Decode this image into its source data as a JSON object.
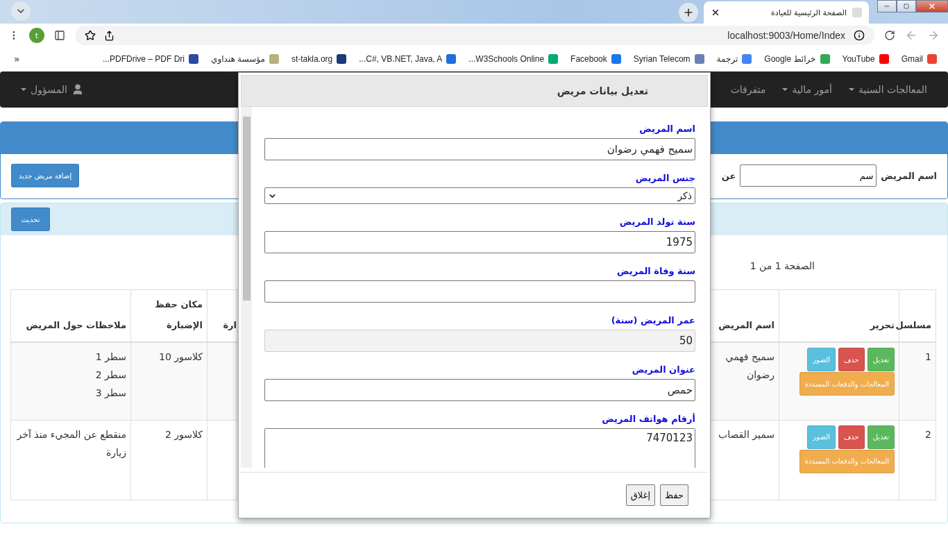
{
  "browser": {
    "tabs": [
      {
        "title": "الصفحة الرئيسية للعيادة",
        "selected": true
      }
    ],
    "address": "localhost:9003/Home/Index",
    "profile_initial": "t",
    "bookmarks": [
      {
        "label": "Gmail",
        "color": "#ea4335"
      },
      {
        "label": "YouTube",
        "color": "#ff0000"
      },
      {
        "label": "خرائط Google",
        "color": "#34a853"
      },
      {
        "label": "ترجمة",
        "color": "#4285f4"
      },
      {
        "label": "Syrian Telecom",
        "color": "#6a7fb5"
      },
      {
        "label": "Facebook",
        "color": "#1877f2"
      },
      {
        "label": "W3Schools Online...",
        "color": "#04aa6d"
      },
      {
        "label": "C#, VB.NET, Java, A...",
        "color": "#1e6fd9"
      },
      {
        "label": "st-takla.org",
        "color": "#1a3a7a"
      },
      {
        "label": "مؤسسة هنداوي",
        "color": "#b5b27a"
      },
      {
        "label": "PDFDrive – PDF Dri...",
        "color": "#2a49a8"
      }
    ],
    "overflow": "«"
  },
  "navbar": {
    "items": [
      {
        "label": "المعالجات السنية",
        "dropdown": true
      },
      {
        "label": "أمور مالية",
        "dropdown": true
      },
      {
        "label": "متفرقات",
        "dropdown": false
      }
    ],
    "user": {
      "label": "المسؤول"
    }
  },
  "search": {
    "label": "اسم المريض",
    "value": "سم",
    "next_label": "عن",
    "add_button": "إضافة مريض جديد"
  },
  "list": {
    "refresh_button": "تحديث",
    "pagination": "الصفحة 1 من 1",
    "columns": [
      "مسلسل",
      "تحرير",
      "اسم المريض",
      null,
      "ارة",
      "مكان حفظ الإضبارة",
      "ملاحظات حول المريض"
    ],
    "rows": [
      {
        "serial": "1",
        "actions": [
          {
            "label": "تعديل",
            "kind": "success"
          },
          {
            "label": "حذف",
            "kind": "danger"
          },
          {
            "label": "الصور",
            "kind": "info"
          },
          {
            "label": "المعالجات والدفعات المسددة",
            "kind": "warning"
          }
        ],
        "name": "سميح فهمي رضوان",
        "location": "كلاسور 10",
        "notes": [
          "سطر 1",
          "سطر 2",
          "سطر 3"
        ]
      },
      {
        "serial": "2",
        "actions": [
          {
            "label": "تعديل",
            "kind": "success"
          },
          {
            "label": "حذف",
            "kind": "danger"
          },
          {
            "label": "الصور",
            "kind": "info"
          },
          {
            "label": "المعالجات والدفعات المسددة",
            "kind": "warning"
          }
        ],
        "name": "سمير القصاب",
        "location": "كلاسور 2",
        "notes": [
          "منقطع عن المجيء منذ آخر زيارة"
        ]
      }
    ]
  },
  "modal": {
    "title": "تعديل بيانات مريض",
    "fields": [
      {
        "label": "اسم المريض",
        "kind": "text",
        "value": "سميح فهمي رضوان",
        "disabled": false
      },
      {
        "label": "جنس المريض",
        "kind": "select",
        "value": "ذكر",
        "disabled": false
      },
      {
        "label": "سنة تولد المريض",
        "kind": "text",
        "value": "1975",
        "disabled": false
      },
      {
        "label": "سنة وفاة المريض",
        "kind": "text",
        "disabled": false
      },
      {
        "label": "عمر المريض (سنة)",
        "kind": "text",
        "value": "50",
        "disabled": true
      },
      {
        "label": "عنوان المريض",
        "kind": "text",
        "value": "حمص",
        "disabled": false
      },
      {
        "label": "أرقام هواتف المريض",
        "kind": "textarea",
        "value": "7470123",
        "disabled": false
      }
    ],
    "buttons": [
      "حفظ",
      "إغلاق"
    ]
  }
}
